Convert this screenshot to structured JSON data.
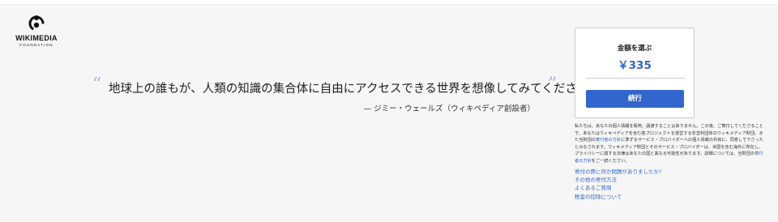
{
  "brand": {
    "name": "WIKIMEDIA",
    "subtitle": "FOUNDATION",
    "logo_icon": "wikimedia-logo"
  },
  "quote": {
    "open_mark": "“",
    "close_mark": "”",
    "text": "地球上の誰もが、人類の知識の集合体に自由にアクセスできる世界を想像してみてください。",
    "author": "— ジミー・ウェールズ（ウィキペディア創設者）"
  },
  "donate": {
    "title": "金額を選ぶ",
    "amount": "￥335",
    "continue_label": "続行"
  },
  "privacy": {
    "part1": "私たちは、あなたの個人情報を販売、譲渡することはありません。この後、ご寄付してくださることで、あなたはウィキペディアを含む各プロジェクトを運営する非営利団体のウィキメディア財団、また当財団の",
    "link1": "寄付者の方針",
    "part2": "に準ずるサービス・プロバイダーへの個人情報の共有に、同意して下さったとみなされます。ウィキメディア財団とそのサービス・プロバイダーは、米国を含む海外に所在し、プライバシーに関する法律はあなたの国と異なる可能性があります。詳細については、当財団の",
    "link2": "寄付者の方針",
    "part3": "をご一読ください。"
  },
  "help_links": [
    "寄付の際に何か問題がありましたか?",
    "その他の寄付方法",
    "よくあるご質問",
    "税金の控除について"
  ],
  "colors": {
    "accent": "#3366cc",
    "background": "#f6f6f6",
    "quote_mark": "#a8b7d6"
  }
}
